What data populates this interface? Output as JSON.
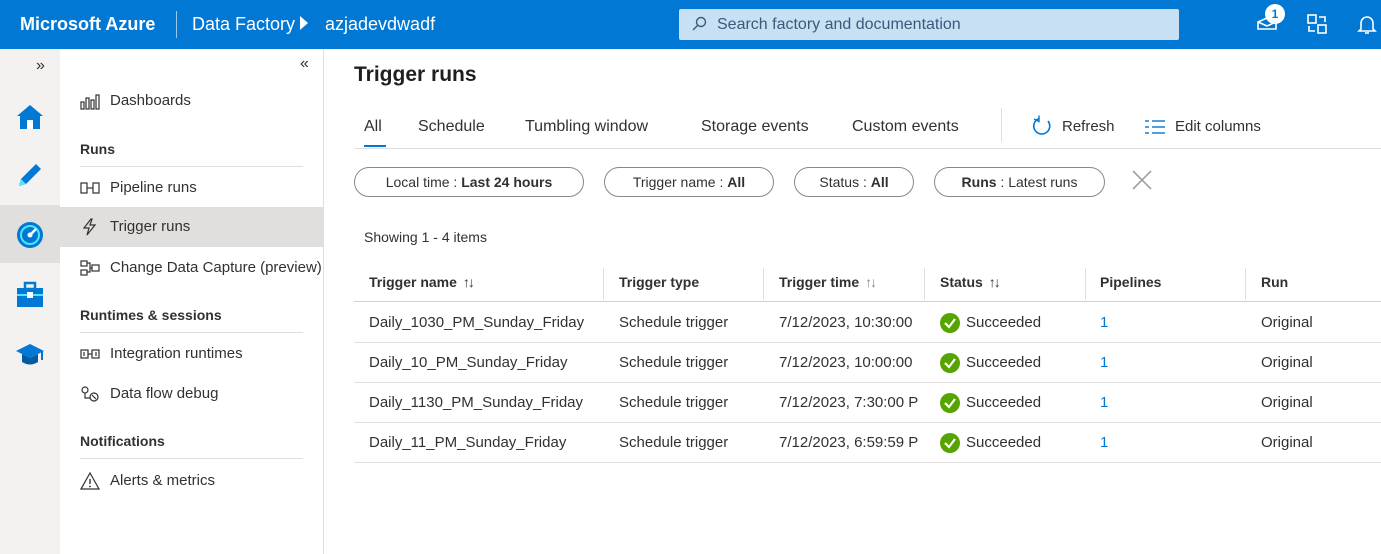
{
  "topbar": {
    "brand": "Microsoft Azure",
    "app": "Data Factory",
    "factory": "azjadevdwadf",
    "search_placeholder": "Search factory and documentation",
    "notification_count": "1",
    "accent": "#0078d4"
  },
  "rail": {
    "items": [
      "home-icon",
      "author-pencil-icon",
      "monitor-icon",
      "manage-toolbox-icon",
      "learning-hat-icon"
    ]
  },
  "nav": {
    "dashboards": "Dashboards",
    "section_runs": "Runs",
    "pipeline_runs": "Pipeline runs",
    "trigger_runs": "Trigger runs",
    "change_data_capture": "Change Data Capture (preview)",
    "section_runtimes": "Runtimes & sessions",
    "integration_runtimes": "Integration runtimes",
    "data_flow_debug": "Data flow debug",
    "section_notifications": "Notifications",
    "alerts_metrics": "Alerts & metrics"
  },
  "main": {
    "title": "Trigger runs",
    "tabs": [
      "All",
      "Schedule",
      "Tumbling window",
      "Storage events",
      "Custom events"
    ],
    "refresh": "Refresh",
    "edit_columns": "Edit columns",
    "filters": {
      "local_time_key": "Local time : ",
      "local_time_val": "Last 24 hours",
      "trigger_name_key": "Trigger name : ",
      "trigger_name_val": "All",
      "status_key": "Status : ",
      "status_val": "All",
      "runs_key": "Runs",
      "runs_val": " : Latest runs"
    },
    "count": "Showing 1 - 4 items",
    "columns": [
      "Trigger name",
      "Trigger type",
      "Trigger time",
      "Status",
      "Pipelines",
      "Run"
    ],
    "rows": [
      {
        "name": "Daily_1030_PM_Sunday_Friday",
        "type": "Schedule trigger",
        "time": "7/12/2023, 10:30:00",
        "status": "Succeeded",
        "pipelines": "1",
        "run": "Original"
      },
      {
        "name": "Daily_10_PM_Sunday_Friday",
        "type": "Schedule trigger",
        "time": "7/12/2023, 10:00:00",
        "status": "Succeeded",
        "pipelines": "1",
        "run": "Original"
      },
      {
        "name": "Daily_1130_PM_Sunday_Friday",
        "type": "Schedule trigger",
        "time": "7/12/2023, 7:30:00 P",
        "status": "Succeeded",
        "pipelines": "1",
        "run": "Original"
      },
      {
        "name": "Daily_11_PM_Sunday_Friday",
        "type": "Schedule trigger",
        "time": "7/12/2023, 6:59:59 P",
        "status": "Succeeded",
        "pipelines": "1",
        "run": "Original"
      }
    ]
  }
}
